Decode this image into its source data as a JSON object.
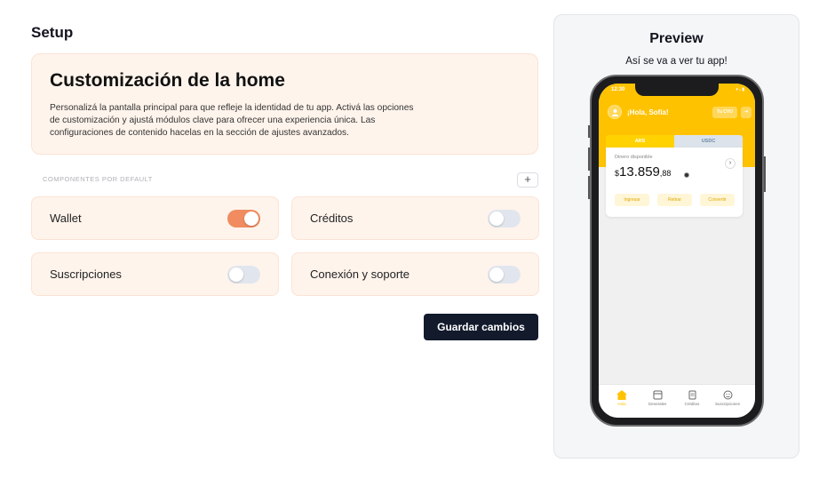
{
  "setup": {
    "title": "Setup"
  },
  "hero": {
    "title": "Customización de la home",
    "description": "Personalizá la pantalla principal para que refleje la identidad de tu app. Activá las opciones de customización y ajustá módulos clave para ofrecer una experiencia única. Las configuraciones de contenido hacelas en la sección de ajustes avanzados."
  },
  "components": {
    "section_label": "COMPONENTES POR DEFAULT",
    "add_label": "+",
    "items": [
      {
        "label": "Wallet",
        "enabled": true
      },
      {
        "label": "Créditos",
        "enabled": false
      },
      {
        "label": "Suscripciones",
        "enabled": false
      },
      {
        "label": "Conexión y soporte",
        "enabled": false
      }
    ]
  },
  "save_button": {
    "label": "Guardar cambios"
  },
  "preview": {
    "title": "Preview",
    "subtitle": "Así se va a ver tu app!",
    "phone": {
      "time": "12:30",
      "status": "▾ ᵢₗ ▮",
      "greeting": "¡Hola, Sofía!",
      "cvu_label": "Tu CVU",
      "exit_label": "⇥",
      "tabs": [
        "ARS",
        "USDC"
      ],
      "available_label": "Dinero disponible",
      "currency": "$",
      "amount": "13.859",
      "amount_decimals": ",88",
      "arrow": "›",
      "actions": [
        "Ingresar",
        "Retirar",
        "Convertir"
      ],
      "nav": [
        "Hola",
        "Generales",
        "Créditos",
        "Suscripciones"
      ]
    },
    "colors": {
      "brand": "#ffc200",
      "accent": "#f08c5f"
    }
  }
}
